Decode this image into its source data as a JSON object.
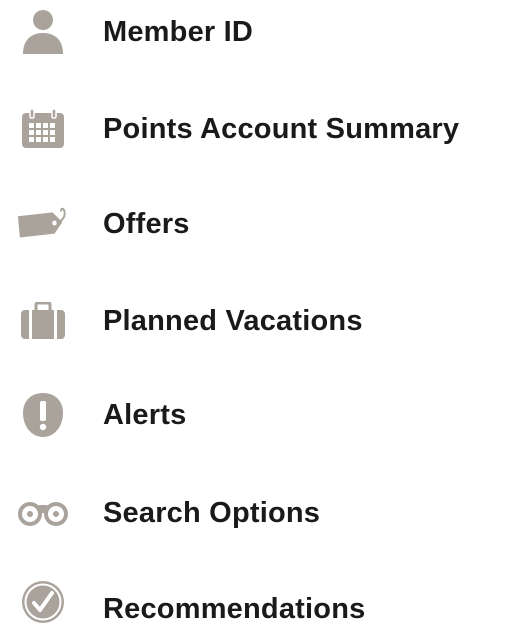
{
  "accent_color": "#aaa39c",
  "text_color": "#1a1a1a",
  "menu": {
    "items": [
      {
        "label": "Member ID",
        "icon": "person-icon"
      },
      {
        "label": "Points Account Summary",
        "icon": "calendar-icon"
      },
      {
        "label": "Offers",
        "icon": "tag-icon"
      },
      {
        "label": "Planned Vacations",
        "icon": "suitcase-icon"
      },
      {
        "label": "Alerts",
        "icon": "exclamation-icon"
      },
      {
        "label": "Search Options",
        "icon": "binoculars-icon"
      },
      {
        "label": "Recommendations",
        "icon": "checkmark-circle-icon"
      }
    ]
  }
}
